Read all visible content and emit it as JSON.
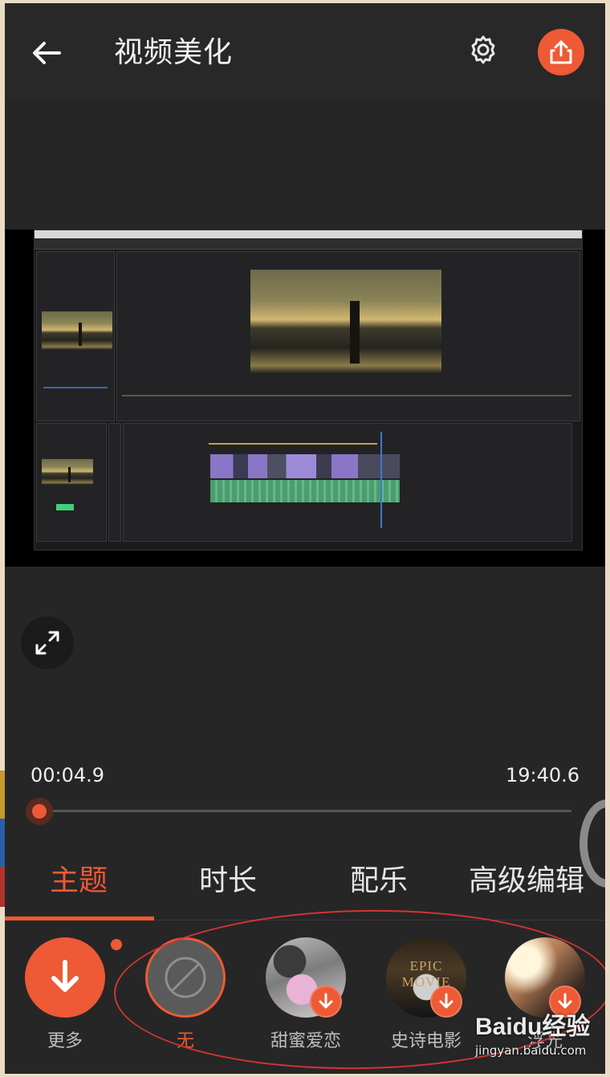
{
  "header": {
    "title": "视频美化",
    "back_icon": "arrow-left-icon",
    "settings_icon": "gear-icon",
    "share_icon": "share-upload-icon"
  },
  "player": {
    "expand_icon": "expand-arrows-icon",
    "current_time": "00:04.9",
    "total_time": "19:40.6",
    "progress_fraction": 0.004
  },
  "tabs": [
    {
      "label": "主题",
      "active": true
    },
    {
      "label": "时长",
      "active": false
    },
    {
      "label": "配乐",
      "active": false
    },
    {
      "label": "高级编辑",
      "active": false
    }
  ],
  "themes": [
    {
      "label": "更多",
      "icon": "download-arrow-icon",
      "selected": false
    },
    {
      "label": "无",
      "icon": "no-symbol-icon",
      "selected": true
    },
    {
      "label": "甜蜜爱恋",
      "icon": "download-badge-icon",
      "selected": false
    },
    {
      "label": "史诗电影",
      "icon": "download-badge-icon",
      "selected": false,
      "thumb_text": "EPIC MOVIE"
    },
    {
      "label": "浮光",
      "icon": "download-badge-icon",
      "selected": false
    }
  ],
  "watermark": {
    "logo": "Baidu经验",
    "url": "jingyan.baidu.com"
  },
  "colors": {
    "accent": "#ed5a35",
    "background": "#262626",
    "annotation": "#d23434"
  }
}
